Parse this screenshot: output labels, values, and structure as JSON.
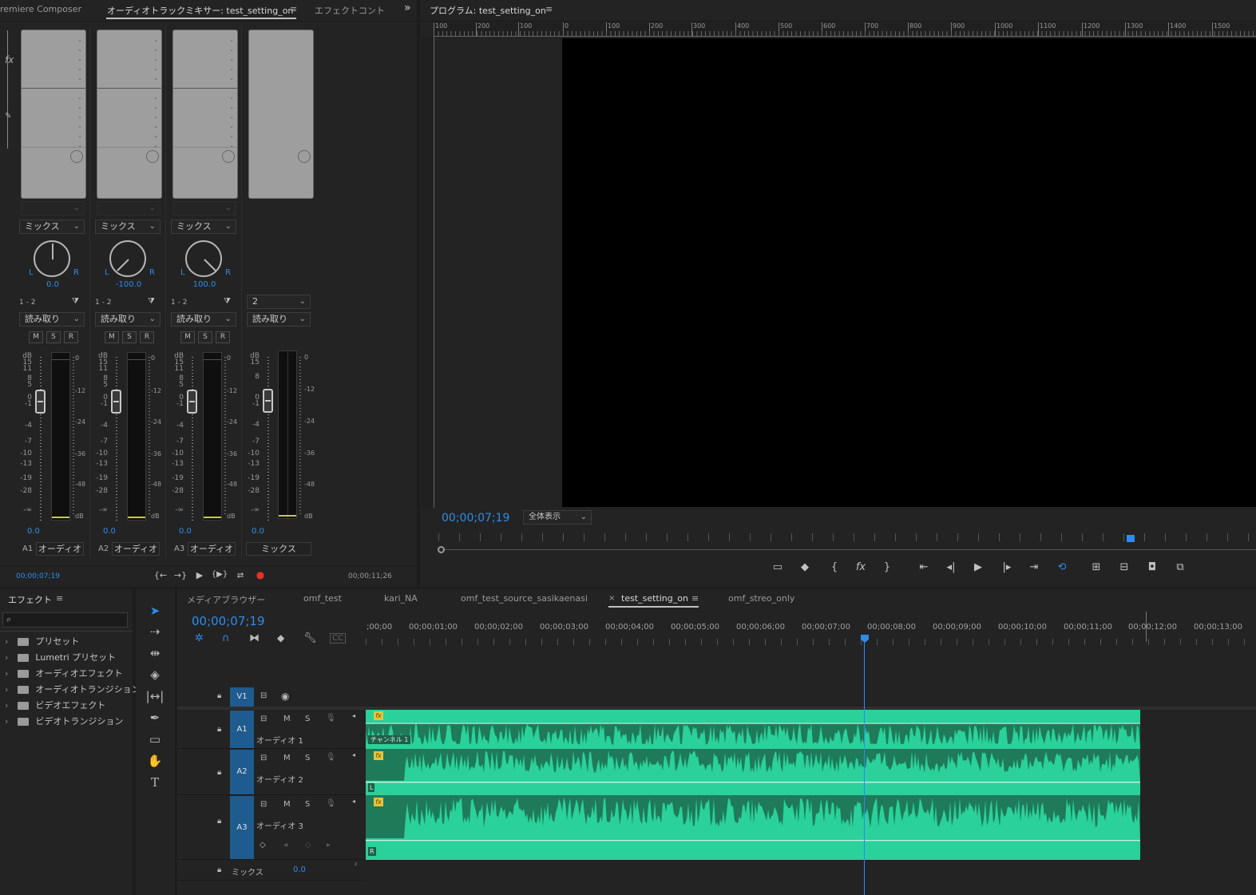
{
  "mixer_panel": {
    "tabs": [
      "remiere Composer",
      "オーディオトラックミキサー: test_setting_on",
      "エフェクトコントロ"
    ],
    "overflow": "»",
    "channels": [
      {
        "mode": "ミックス",
        "pan_value": "0.0",
        "pan_deg": 0,
        "routing": "1 - 2",
        "automation": "読み取り",
        "volume": "0.0",
        "id": "A1",
        "name": "オーディオ"
      },
      {
        "mode": "ミックス",
        "pan_value": "-100.0",
        "pan_deg": -135,
        "routing": "1 - 2",
        "automation": "読み取り",
        "volume": "0.0",
        "id": "A2",
        "name": "オーディオ"
      },
      {
        "mode": "ミックス",
        "pan_value": "100.0",
        "pan_deg": 135,
        "routing": "1 - 2",
        "automation": "読み取り",
        "volume": "0.0",
        "id": "A3",
        "name": "オーディオ"
      }
    ],
    "master": {
      "routing": "2",
      "automation": "読み取り",
      "volume": "0.0",
      "name": "ミックス"
    },
    "pan_l": "L",
    "pan_r": "R",
    "msr": [
      "M",
      "S",
      "R"
    ],
    "db_label": "dB",
    "fader_scale": [
      "15",
      "11",
      "8",
      "5",
      "0",
      "-1",
      "-4",
      "-7",
      "-10",
      "-13",
      "-19",
      "-28",
      "-∞"
    ],
    "master_fader_scale": [
      "15",
      "8",
      "0",
      "-1",
      "-4",
      "-7",
      "-10",
      "-13",
      "-19",
      "-28",
      "-∞"
    ],
    "meter_scale": [
      "0",
      "-12",
      "-24",
      "-36",
      "-48",
      "dB"
    ],
    "current_time": "00;00;07;19",
    "end_time": "00;00;11;26",
    "transport": [
      "{←",
      "→}",
      "▶",
      "{▶}",
      "⮂",
      "●"
    ]
  },
  "program_monitor": {
    "title": "プログラム: test_setting_on",
    "ruler_h": [
      "100",
      "200",
      "100",
      "0",
      "100",
      "200",
      "300",
      "400",
      "500",
      "600",
      "700",
      "800",
      "900",
      "1000",
      "1100",
      "1200",
      "1300",
      "1400",
      "1500"
    ],
    "timecode": "00;00;07;19",
    "zoom": "全体表示"
  },
  "effects_panel": {
    "title": "エフェクト",
    "search_placeholder": "",
    "items": [
      "プリセット",
      "Lumetri プリセット",
      "オーディオエフェクト",
      "オーディオトランジション",
      "ビデオエフェクト",
      "ビデオトランジション"
    ]
  },
  "timeline": {
    "tabs": [
      "メディアブラウザー",
      "omf_test",
      "kari_NA",
      "omf_test_source_sasikaenasi",
      "test_setting_on",
      "omf_streo_only"
    ],
    "close": "×",
    "timecode": "00;00;07;19",
    "ruler": [
      ";00;00",
      "00;00;01;00",
      "00;00;02;00",
      "00;00;03;00",
      "00;00;04;00",
      "00;00;05;00",
      "00;00;06;00",
      "00;00;07;00",
      "00;00;08;00",
      "00;00;09;00",
      "00;00;10;00",
      "00;00;11;00",
      "00;00;12;00",
      "00;00;13;00"
    ],
    "tracks": {
      "v1": "V1",
      "a1": {
        "id": "A1",
        "name": "オーディオ 1",
        "clip_label": "チャンネル 1"
      },
      "a2": {
        "id": "A2",
        "name": "オーディオ 2",
        "clip_label": "L"
      },
      "a3": {
        "id": "A3",
        "name": "オーディオ 3",
        "clip_label": "R"
      },
      "mix": {
        "name": "ミックス",
        "value": "0.0"
      }
    },
    "fx_badge": "fx"
  },
  "colors": {
    "accent": "#2d8ceb",
    "clip": "#2ad19a",
    "clip_dark": "#1f7a5a",
    "track_blue": "#1e5b8f",
    "record": "#e8302a"
  }
}
